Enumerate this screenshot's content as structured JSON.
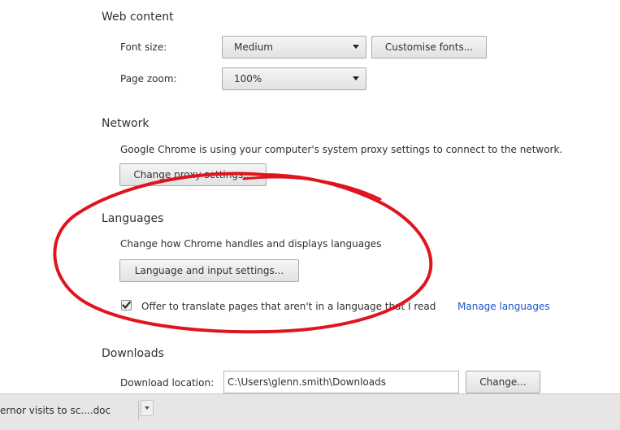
{
  "web_content": {
    "heading": "Web content",
    "font_size_label": "Font size:",
    "font_size_value": "Medium",
    "customise_fonts_label": "Customise fonts...",
    "page_zoom_label": "Page zoom:",
    "page_zoom_value": "100%"
  },
  "network": {
    "heading": "Network",
    "description": "Google Chrome is using your computer's system proxy settings to connect to the network.",
    "change_proxy_label": "Change proxy settings..."
  },
  "languages": {
    "heading": "Languages",
    "description": "Change how Chrome handles and displays languages",
    "settings_button_label": "Language and input settings...",
    "offer_translate_label": "Offer to translate pages that aren't in a language that I read",
    "offer_translate_checked": true,
    "manage_languages_label": "Manage languages"
  },
  "downloads": {
    "heading": "Downloads",
    "location_label": "Download location:",
    "location_value": "C:\\Users\\glenn.smith\\Downloads",
    "change_button_label": "Change..."
  },
  "download_bar": {
    "item_text": "ernor visits to sc....doc"
  },
  "colors": {
    "link": "#1a56c9",
    "annotation": "#e0141e",
    "download_bar_bg": "#e6e6e6"
  },
  "icons": {
    "dropdown": "chevron-down-icon",
    "checkbox": "checkmark-icon",
    "download_menu": "chevron-down-icon"
  }
}
